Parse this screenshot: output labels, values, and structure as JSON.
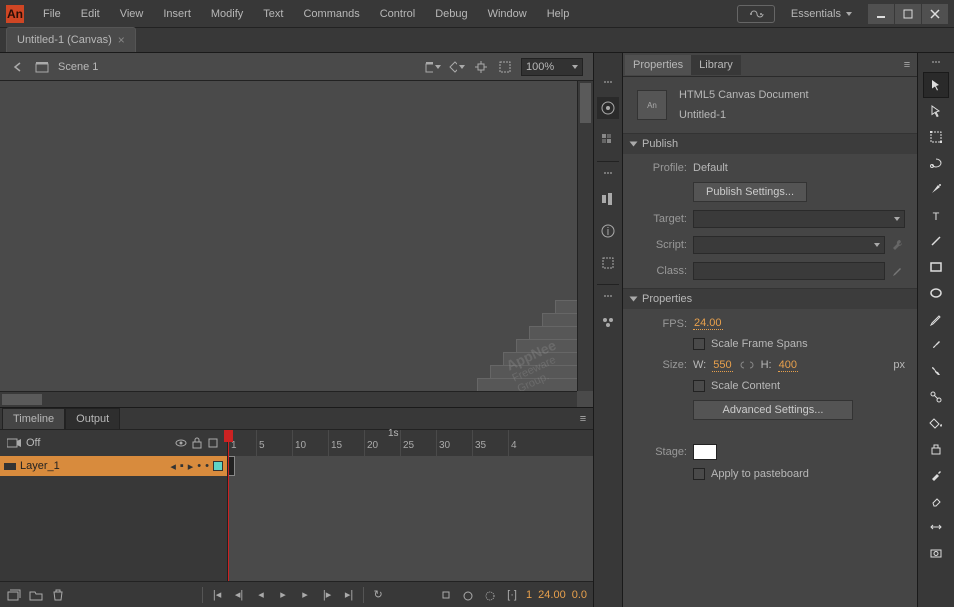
{
  "app_logo": "An",
  "menubar": [
    "File",
    "Edit",
    "View",
    "Insert",
    "Modify",
    "Text",
    "Commands",
    "Control",
    "Debug",
    "Window",
    "Help"
  ],
  "workspace": "Essentials",
  "doc_tab": "Untitled-1 (Canvas)",
  "stage": {
    "scene": "Scene 1",
    "zoom": "100%"
  },
  "watermark": {
    "line1": "AppNee",
    "line2": "Freeware",
    "line3": "Group."
  },
  "timeline": {
    "tabs": [
      "Timeline",
      "Output"
    ],
    "camera_label": "Off",
    "ticks": [
      "1",
      "5",
      "10",
      "15",
      "20",
      "25",
      "30",
      "35",
      "4"
    ],
    "ts_label": "1s",
    "layer_name": "Layer_1",
    "frame_num": "1",
    "fps_display": "24.00",
    "elapsed": "0.0"
  },
  "props": {
    "tabs": [
      "Properties",
      "Library"
    ],
    "doc_type": "HTML5 Canvas Document",
    "doc_name": "Untitled-1",
    "publish": {
      "title": "Publish",
      "profile_label": "Profile:",
      "profile_value": "Default",
      "settings_btn": "Publish Settings...",
      "target_label": "Target:",
      "script_label": "Script:",
      "class_label": "Class:"
    },
    "properties": {
      "title": "Properties",
      "fps_label": "FPS:",
      "fps_value": "24.00",
      "scale_spans": "Scale Frame Spans",
      "size_label": "Size:",
      "w_label": "W:",
      "w_value": "550",
      "h_label": "H:",
      "h_value": "400",
      "px": "px",
      "scale_content": "Scale Content",
      "advanced_btn": "Advanced Settings...",
      "stage_label": "Stage:",
      "pasteboard": "Apply to pasteboard"
    }
  }
}
